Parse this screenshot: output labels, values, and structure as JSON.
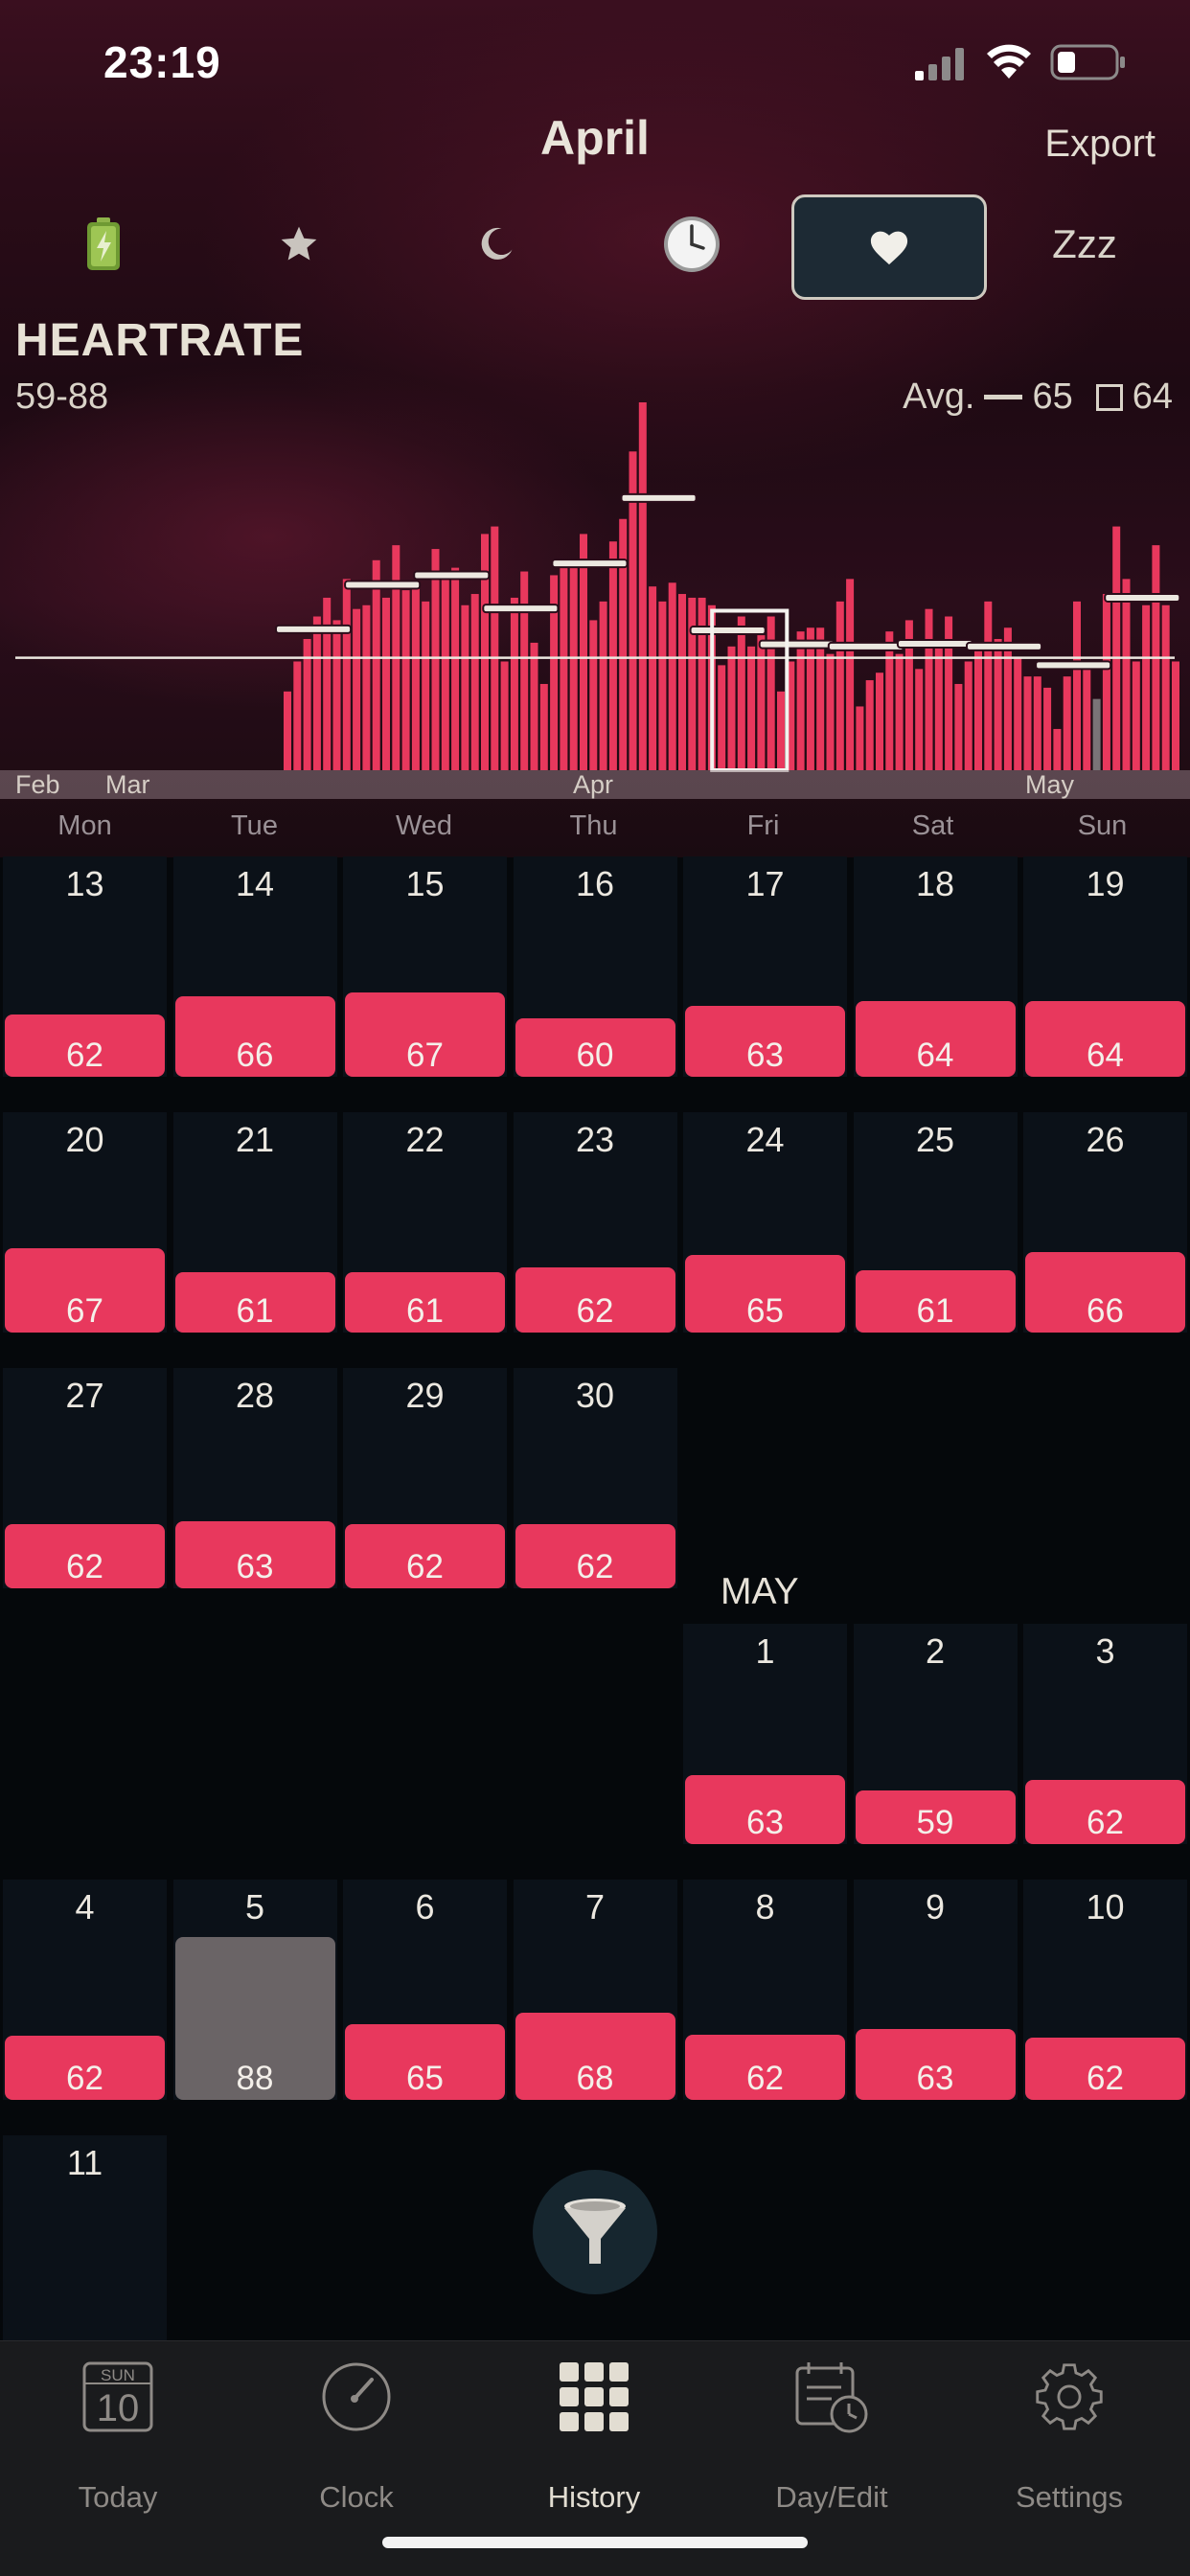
{
  "status": {
    "time": "23:19"
  },
  "header": {
    "title": "April",
    "export_label": "Export"
  },
  "categories": [
    {
      "name": "battery-icon"
    },
    {
      "name": "star-icon"
    },
    {
      "name": "moon-icon"
    },
    {
      "name": "clock-icon"
    },
    {
      "name": "heart-icon",
      "selected": true
    },
    {
      "name": "zzz",
      "label": "Zzz"
    }
  ],
  "metric": {
    "name": "HEARTRATE",
    "range": "59-88",
    "avg_label": "Avg.",
    "avg_value": "65",
    "box_value": "64"
  },
  "chart_data": {
    "type": "bar",
    "values": [
      56,
      64,
      70,
      76,
      81,
      75,
      86,
      78,
      79,
      91,
      81,
      95,
      83,
      84,
      80,
      94,
      87,
      89,
      79,
      82,
      98,
      100,
      64,
      81,
      88,
      69,
      58,
      87,
      91,
      89,
      98,
      75,
      80,
      96,
      102,
      120,
      221,
      84,
      80,
      85,
      82,
      81,
      81,
      79,
      63,
      68,
      76,
      68,
      71,
      76,
      56,
      64,
      72,
      73,
      73,
      66,
      80,
      86,
      52,
      59,
      61,
      72,
      66,
      75,
      62,
      78,
      68,
      76,
      58,
      64,
      68,
      80,
      70,
      73,
      65,
      60,
      60,
      57,
      46,
      60,
      80,
      62,
      54,
      82,
      100,
      86,
      64,
      79,
      95,
      79,
      64
    ],
    "highlight": {
      "index": 82,
      "value": 88,
      "color": "#7a7477"
    },
    "bar_color": "#e8385d",
    "avg_line": 65,
    "selected_week_start": 44,
    "month_labels": [
      "Feb",
      "Mar",
      "Apr",
      "May"
    ]
  },
  "weekdays": [
    "Mon",
    "Tue",
    "Wed",
    "Thu",
    "Fri",
    "Sat",
    "Sun"
  ],
  "calendar": {
    "weeks": [
      [
        {
          "d": "13",
          "v": "62",
          "p": 0.37
        },
        {
          "d": "14",
          "v": "66",
          "p": 0.48
        },
        {
          "d": "15",
          "v": "67",
          "p": 0.5
        },
        {
          "d": "16",
          "v": "60",
          "p": 0.35
        },
        {
          "d": "17",
          "v": "63",
          "p": 0.42
        },
        {
          "d": "18",
          "v": "64",
          "p": 0.45
        },
        {
          "d": "19",
          "v": "64",
          "p": 0.45
        }
      ],
      [
        {
          "d": "20",
          "v": "67",
          "p": 0.5
        },
        {
          "d": "21",
          "v": "61",
          "p": 0.36
        },
        {
          "d": "22",
          "v": "61",
          "p": 0.36
        },
        {
          "d": "23",
          "v": "62",
          "p": 0.39
        },
        {
          "d": "24",
          "v": "65",
          "p": 0.46
        },
        {
          "d": "25",
          "v": "61",
          "p": 0.37
        },
        {
          "d": "26",
          "v": "66",
          "p": 0.48
        }
      ],
      [
        {
          "d": "27",
          "v": "62",
          "p": 0.38
        },
        {
          "d": "28",
          "v": "63",
          "p": 0.4
        },
        {
          "d": "29",
          "v": "62",
          "p": 0.38
        },
        {
          "d": "30",
          "v": "62",
          "p": 0.38
        }
      ]
    ],
    "may_label": "MAY",
    "may_weeks": [
      [
        null,
        null,
        null,
        null,
        {
          "d": "1",
          "v": "63",
          "p": 0.41
        },
        {
          "d": "2",
          "v": "59",
          "p": 0.32
        },
        {
          "d": "3",
          "v": "62",
          "p": 0.38
        }
      ],
      [
        {
          "d": "4",
          "v": "62",
          "p": 0.38
        },
        {
          "d": "5",
          "v": "88",
          "p": 0.97,
          "gray": true
        },
        {
          "d": "6",
          "v": "65",
          "p": 0.45
        },
        {
          "d": "7",
          "v": "68",
          "p": 0.52
        },
        {
          "d": "8",
          "v": "62",
          "p": 0.39
        },
        {
          "d": "9",
          "v": "63",
          "p": 0.42
        },
        {
          "d": "10",
          "v": "62",
          "p": 0.37
        }
      ],
      [
        {
          "d": "11",
          "v": "",
          "p": 0
        }
      ]
    ]
  },
  "tabs": [
    {
      "label": "Today",
      "icon": "calendar-day-icon",
      "cal_day": "SUN",
      "cal_num": "10"
    },
    {
      "label": "Clock",
      "icon": "gauge-icon"
    },
    {
      "label": "History",
      "icon": "grid-icon",
      "active": true
    },
    {
      "label": "Day/Edit",
      "icon": "calendar-edit-icon"
    },
    {
      "label": "Settings",
      "icon": "gear-icon"
    }
  ]
}
